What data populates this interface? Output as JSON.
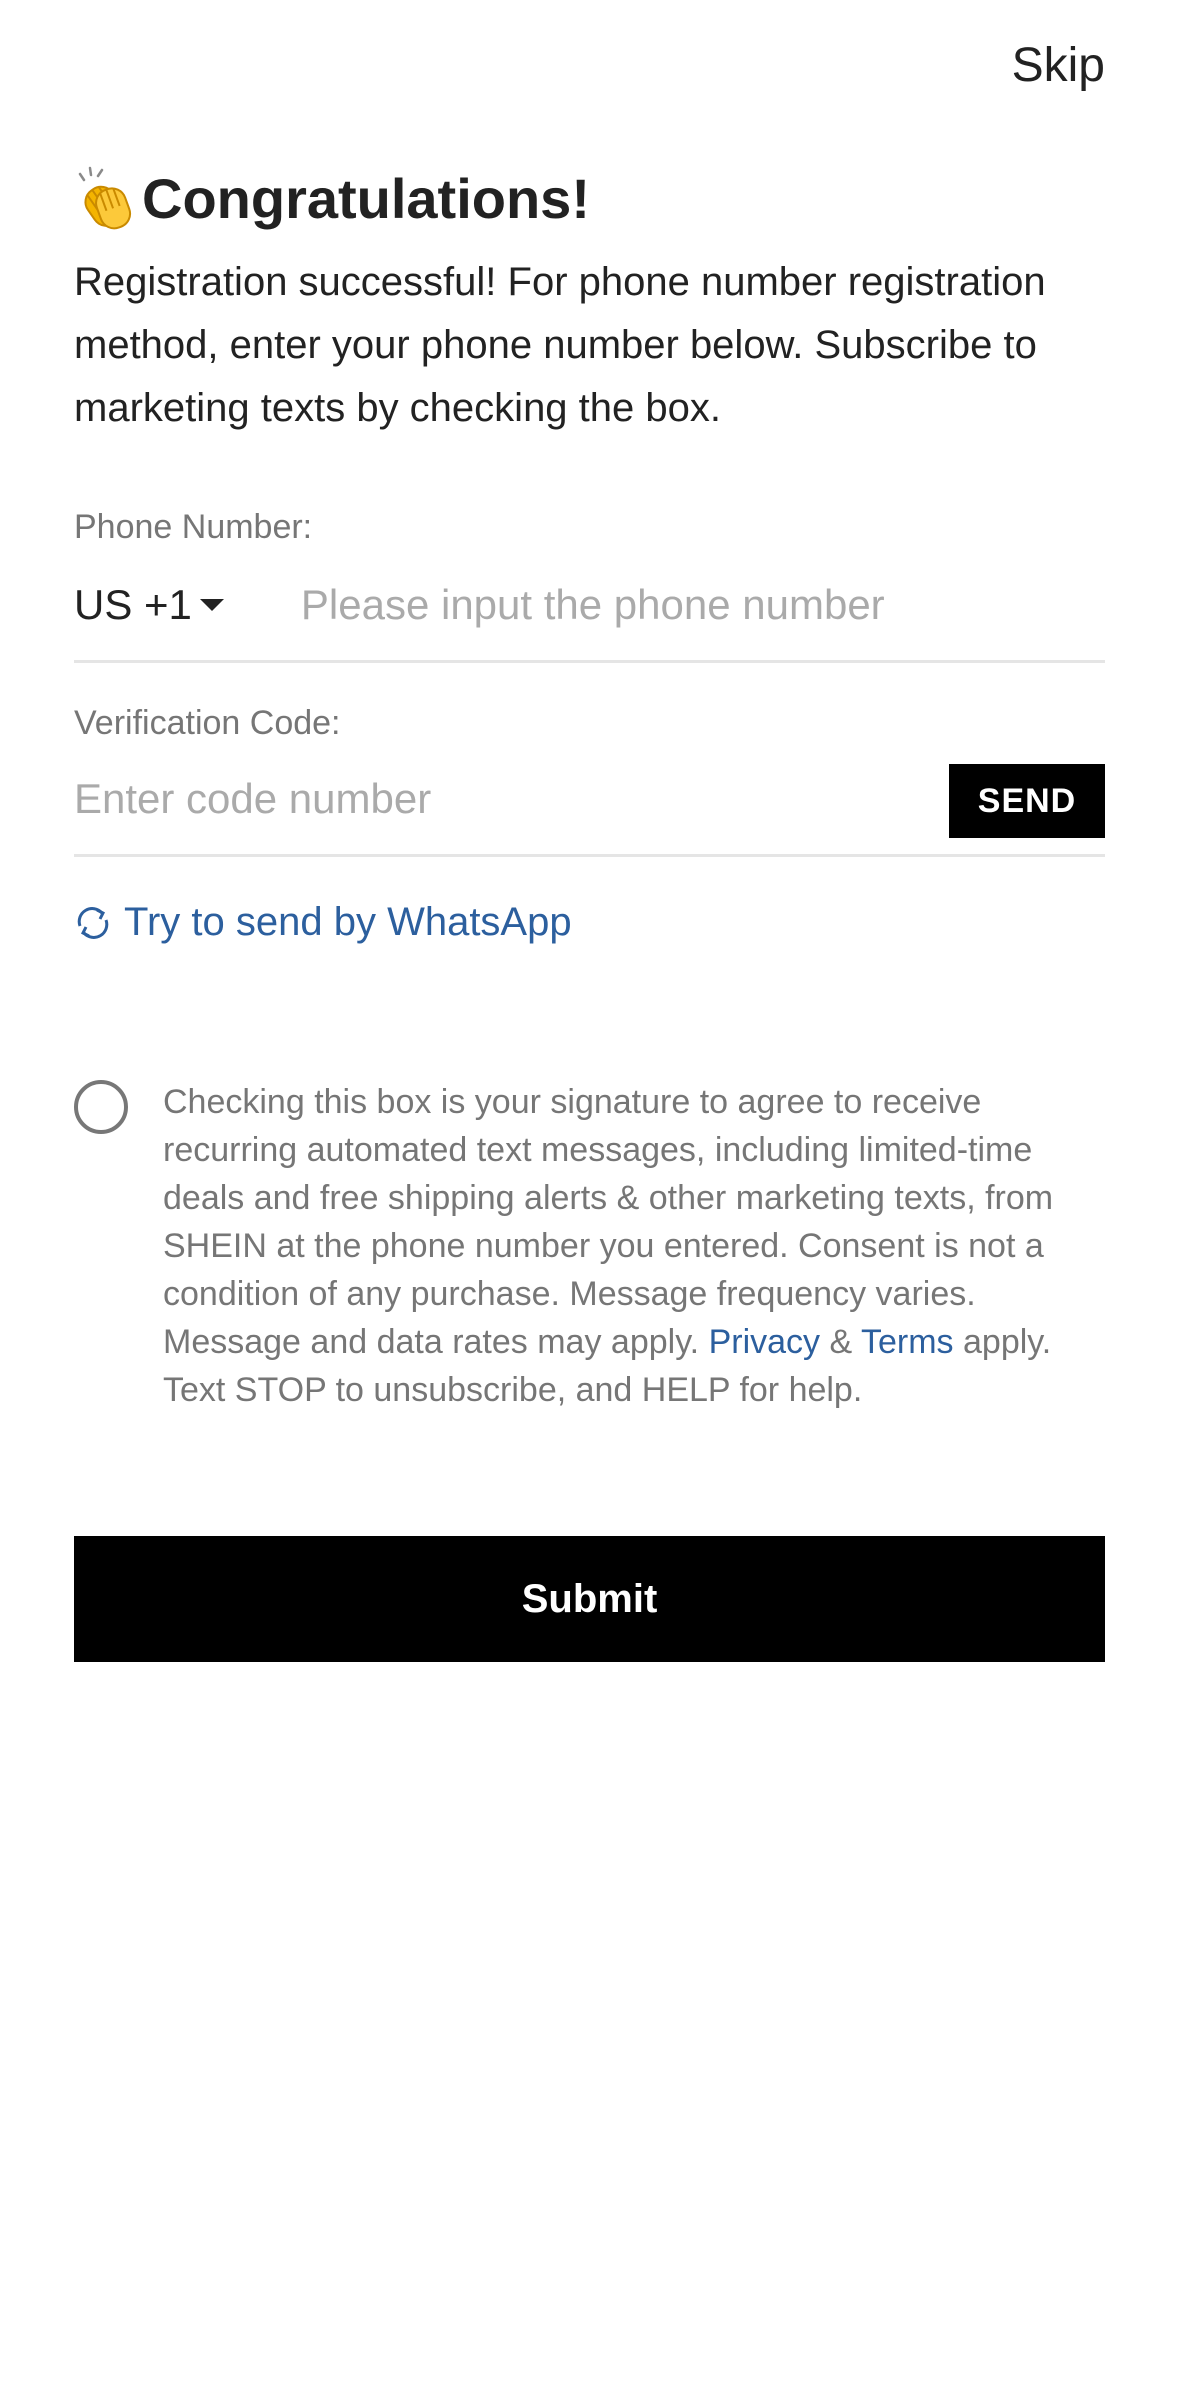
{
  "header": {
    "skip_label": "Skip"
  },
  "title": {
    "icon": "clapping-hands-icon",
    "text": "Congratulations!"
  },
  "intro": {
    "text": "Registration successful! For phone number registration method, enter your phone number below. Subscribe to marketing texts by checking the box."
  },
  "phone": {
    "label": "Phone Number:",
    "country_code": "US +1",
    "value": "",
    "placeholder": "Please input the phone number"
  },
  "verification": {
    "label": "Verification Code:",
    "value": "",
    "placeholder": "Enter code number",
    "send_label": "SEND"
  },
  "whatsapp": {
    "icon": "refresh-icon",
    "label": "Try to send by WhatsApp"
  },
  "consent": {
    "checked": false,
    "text_before": "Checking this box is your signature to agree to receive recurring automated text messages, including limited-time deals and free shipping alerts & other marketing texts, from SHEIN at the phone number you entered. Consent is not a condition of any purchase. Message frequency varies. Message and data rates may apply. ",
    "privacy_link": "Privacy",
    "amp": " & ",
    "terms_link": "Terms",
    "text_after": " apply. Text STOP to unsubscribe, and HELP for help."
  },
  "submit": {
    "label": "Submit"
  },
  "colors": {
    "link": "#2c5f9e",
    "primary_button": "#000000",
    "muted_text": "#767676",
    "placeholder": "#aaaaaa"
  }
}
